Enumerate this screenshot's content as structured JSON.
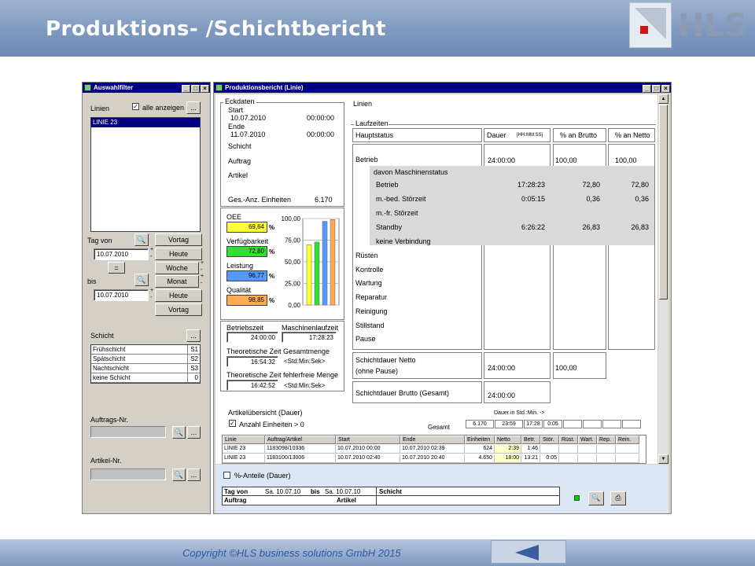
{
  "slide": {
    "title": "Produktions- /Schichtbericht",
    "logo_text": "HLS",
    "copyright": "Copyright ©HLS business solutions GmbH 2015",
    "back_icon": "triangle-left-icon"
  },
  "filter_window": {
    "title": "Auswahlfilter",
    "lines_label": "Linien",
    "show_all_label": "alle anzeigen",
    "show_all_checked": "✓",
    "more": "...",
    "selected_line": "LINIE 23",
    "tag_von_label": "Tag von",
    "date_from": "10.07.2010",
    "equals_btn": "=",
    "bis_label": "bis",
    "date_to": "10.07.2010",
    "buttons": [
      "Vortag",
      "Heute",
      "Woche",
      "Monat",
      "Heute",
      "Vortag"
    ],
    "plus": "+",
    "minus": "-",
    "shift_label": "Schicht",
    "shifts": [
      {
        "name": "Frühschicht",
        "code": "S1"
      },
      {
        "name": "Spätschicht",
        "code": "S2"
      },
      {
        "name": "Nachtschicht",
        "code": "S3"
      },
      {
        "name": "keine Schicht",
        "code": "0"
      }
    ],
    "order_label": "Auftrags-Nr.",
    "article_label": "Artikel-Nr."
  },
  "report_window": {
    "title": "Produktionsbericht (Linie)",
    "eckdaten": {
      "title": "Eckdaten",
      "start_label": "Start",
      "start_date": "10.07.2010",
      "start_time": "00:00:00",
      "end_label": "Ende",
      "end_date": "11.07.2010",
      "end_time": "00:00:00",
      "shift_label": "Schicht",
      "order_label": "Auftrag",
      "article_label": "Artikel",
      "units_label": "Ges.-Anz. Einheiten",
      "units_value": "6.170"
    },
    "kpis": [
      {
        "label": "OEE",
        "value": "69,64",
        "unit": "%",
        "color": "#ffff33"
      },
      {
        "label": "Verfügbarkeit",
        "value": "72,80",
        "unit": "%",
        "color": "#33dd33"
      },
      {
        "label": "Leistung",
        "value": "96,77",
        "unit": "%",
        "color": "#5599ff"
      },
      {
        "label": "Qualität",
        "value": "98,85",
        "unit": "%",
        "color": "#ffaa55"
      }
    ],
    "chart_data": {
      "type": "bar",
      "categories": [
        "OEE",
        "Verfügbarkeit",
        "Leistung",
        "Qualität"
      ],
      "values": [
        69.64,
        72.8,
        96.77,
        98.85
      ],
      "colors": [
        "#ffff33",
        "#33dd33",
        "#5599ff",
        "#ffaa55"
      ],
      "ylim": [
        0,
        100
      ],
      "yticks": [
        "0,00",
        "25,00",
        "50,00",
        "75,00",
        "100,00"
      ],
      "grid": true
    },
    "times": {
      "betriebszeit_label": "Betriebszeit",
      "betriebszeit_value": "24:00:00",
      "maschinenlaufzeit_label": "Maschinenlaufzeit",
      "maschinenlaufzeit_value": "17:28:23",
      "theo1_label": "Theoretische Zeit",
      "theo1_value": "16:54:32",
      "gesamtmenge_label": "Gesamtmenge",
      "gesamtmenge_value": "<Std:Min:Sek>",
      "theo2_label": "Theoretische Zeit",
      "theo2_value": "16:42:52",
      "fehlerfrei_label": "fehlerfreie Menge",
      "fehlerfrei_value": "<Std:Min:Sek>"
    },
    "status": {
      "linien_label": "Linien",
      "laufzeiten_label": "Laufzeiten",
      "col_hauptstatus": "Hauptstatus",
      "col_dauer": "Dauer",
      "col_dauer_fmt": "[HH:MM:SS]",
      "col_brutto": "% an Brutto",
      "col_netto": "% an Netto",
      "betrieb_label": "Betrieb",
      "betrieb_dauer": "24:00:00",
      "betrieb_brutto": "100,00",
      "betrieb_netto": "100,00",
      "machine_status_label": "davon Maschinenstatus",
      "sub_rows": [
        {
          "label": "Betrieb",
          "dauer": "17:28:23",
          "brutto": "72,80",
          "netto": "72,80"
        },
        {
          "label": "m.-bed. Störzeit",
          "dauer": "0:05:15",
          "brutto": "0,36",
          "netto": "0,36"
        },
        {
          "label": "m.-fr. Störzeit",
          "dauer": "",
          "brutto": "",
          "netto": ""
        },
        {
          "label": "Standby",
          "dauer": "6:26:22",
          "brutto": "26,83",
          "netto": "26,83"
        },
        {
          "label": "keine Verbindung",
          "dauer": "",
          "brutto": "",
          "netto": ""
        }
      ],
      "other_rows": [
        "Rüsten",
        "Kontrolle",
        "Wartung",
        "Reparatur",
        "Reinigung",
        "Stillstand",
        "Pause"
      ],
      "netto_label": "Schichtdauer Netto",
      "netto_sub": "(ohne Pause)",
      "netto_dauer": "24:00:00",
      "netto_brutto": "100,00",
      "brutto_label": "Schichtdauer Brutto (Gesamt)",
      "brutto_dauer": "24:00:00"
    },
    "article_overview": {
      "title": "Artikelübersicht (Dauer)",
      "checkbox_label": "Anzahl Einheiten > 0",
      "checked": "✓",
      "duration_caption": "Dauer in Std.:Min. ->",
      "gesamt_label": "Gesamt",
      "totals": [
        "6.170",
        "23:59",
        "17:28",
        "0:05",
        "",
        "",
        "",
        ""
      ],
      "columns": [
        "Linie",
        "Auftrag/Artikel",
        "Start",
        "Ende",
        "Einheiten",
        "Netto",
        "Betr.",
        "Stör.",
        "Rüst.",
        "Wart.",
        "Rep.",
        "Rein."
      ],
      "rows": [
        [
          "LINIE 23",
          "1183098/10336",
          "10.07.2010 00:00",
          "10.07.2010 02:39",
          "624",
          "2:39",
          "1:46",
          "",
          "",
          "",
          "",
          ""
        ],
        [
          "LINIE 23",
          "1183100/13006",
          "10.07.2010 02:40",
          "10.07.2010 20:40",
          "4.650",
          "18:00",
          "13:21",
          "0:05",
          "",
          "",
          "",
          ""
        ]
      ]
    },
    "footer": {
      "percent_label": "%-Anteile (Dauer)",
      "tag_von_label": "Tag von",
      "tag_von_value": "Sa. 10.07.10",
      "bis_label": "bis",
      "bis_value": "Sa. 10.07.10",
      "schicht_label": "Schicht",
      "auftrag_label": "Auftrag",
      "artikel_label": "Artikel"
    }
  }
}
